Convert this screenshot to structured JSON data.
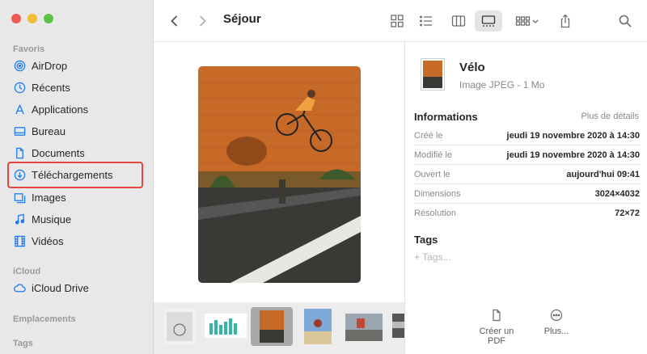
{
  "window": {
    "controls": [
      "close",
      "minimize",
      "zoom"
    ]
  },
  "sidebar": {
    "favorites_title": "Favoris",
    "favorites": [
      {
        "label": "AirDrop",
        "icon": "airdrop-icon"
      },
      {
        "label": "Récents",
        "icon": "clock-icon"
      },
      {
        "label": "Applications",
        "icon": "applications-icon"
      },
      {
        "label": "Bureau",
        "icon": "desktop-icon"
      },
      {
        "label": "Documents",
        "icon": "document-icon"
      },
      {
        "label": "Téléchargements",
        "icon": "download-icon",
        "highlighted": true
      },
      {
        "label": "Images",
        "icon": "image-icon"
      },
      {
        "label": "Musique",
        "icon": "music-icon"
      },
      {
        "label": "Vidéos",
        "icon": "film-icon"
      }
    ],
    "icloud_title": "iCloud",
    "icloud": [
      {
        "label": "iCloud Drive",
        "icon": "cloud-icon"
      }
    ],
    "locations_title": "Emplacements",
    "tags_title": "Tags"
  },
  "toolbar": {
    "title": "Séjour",
    "back_icon": "chevron-left-icon",
    "forward_icon": "chevron-right-icon",
    "views": [
      "icon-view-icon",
      "list-view-icon",
      "column-view-icon",
      "gallery-view-icon"
    ],
    "active_view": "gallery-view-icon",
    "group_icon": "group-icon",
    "share_icon": "share-icon",
    "search_icon": "search-icon"
  },
  "info": {
    "file_name": "Vélo",
    "file_kind": "Image JPEG - 1 Mo",
    "section_title": "Informations",
    "more_details": "Plus de détails",
    "rows": [
      {
        "label": "Créé le",
        "value": "jeudi 19 novembre 2020 à 14:30"
      },
      {
        "label": "Modifié le",
        "value": "jeudi 19 novembre 2020 à 14:30"
      },
      {
        "label": "Ouvert le",
        "value": "aujourd'hui 09:41"
      },
      {
        "label": "Dimensions",
        "value": "3024×4032"
      },
      {
        "label": "Résolution",
        "value": "72×72"
      }
    ],
    "tags_title": "Tags",
    "tags_placeholder": "+ Tags...",
    "actions": [
      {
        "label": "Créer un PDF",
        "icon": "pdf-icon"
      },
      {
        "label": "Plus...",
        "icon": "more-icon"
      }
    ]
  },
  "colors": {
    "accent": "#1b7cf4",
    "highlight_border": "#e2453d",
    "sidebar_bg": "#e9e8e8"
  }
}
